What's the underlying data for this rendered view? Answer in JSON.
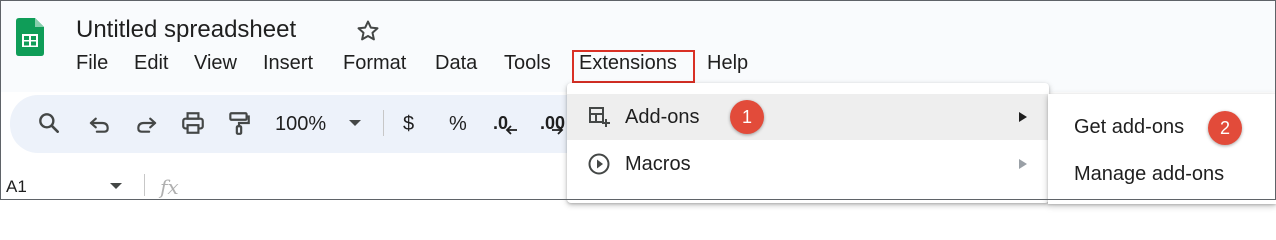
{
  "app": {
    "title": "Untitled spreadsheet",
    "logo_icon": "google-sheets-logo-icon",
    "star_icon": "star-outline-icon"
  },
  "menubar": {
    "items": [
      "File",
      "Edit",
      "View",
      "Insert",
      "Format",
      "Data",
      "Tools",
      "Extensions",
      "Help"
    ],
    "highlighted": "Extensions"
  },
  "toolbar": {
    "icons": [
      "search-icon",
      "undo-icon",
      "redo-icon",
      "print-icon",
      "paint-format-icon"
    ],
    "zoom": "100%",
    "currency": "$",
    "percent": "%",
    "decrease_decimal": ".0",
    "increase_decimal": ".00"
  },
  "formula_bar": {
    "cell_ref": "A1",
    "fx": "fx"
  },
  "extensions_menu": {
    "items": [
      {
        "label": "Add-ons",
        "icon": "add-ons-icon",
        "badge": "1"
      },
      {
        "label": "Macros",
        "icon": "macros-play-icon"
      }
    ]
  },
  "addons_submenu": {
    "items": [
      {
        "label": "Get add-ons",
        "badge": "2"
      },
      {
        "label": "Manage add-ons"
      }
    ]
  },
  "colors": {
    "highlight_box": "#d93025",
    "badge": "#e24b3a",
    "sheets_green": "#0f9d58",
    "toolbar_bg": "#edf2fa"
  }
}
